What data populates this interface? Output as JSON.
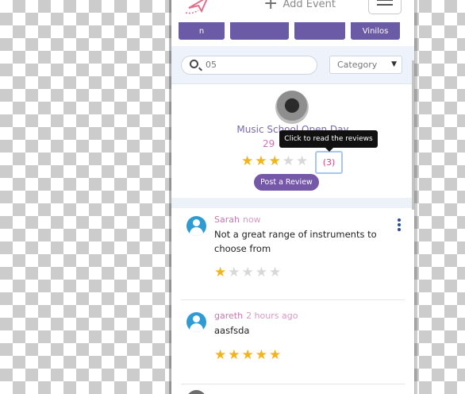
{
  "header": {
    "add_event_label": "Add Event",
    "plus_icon": "plus-icon",
    "menu_icon": "hamburger-icon"
  },
  "chips": [
    "n",
    "",
    "",
    "Vinilos"
  ],
  "search": {
    "value": "05",
    "placeholder": "Search"
  },
  "category": {
    "selected": "Category"
  },
  "event": {
    "title": "Music School Open Day",
    "date": "29",
    "rating": 3,
    "max_rating": 5,
    "review_count": "(3)",
    "tooltip": "Click to read the reviews",
    "post_review_label": "Post a Review"
  },
  "reviews": [
    {
      "name": "Sarah",
      "time": "now",
      "text": "Not a great range of instruments to choose from",
      "rating": 1
    },
    {
      "name": "gareth",
      "time": "2 hours ago",
      "text": "aasfsda",
      "rating": 5
    }
  ],
  "colors": {
    "accent": "#7658a8",
    "star": "#f3b41b",
    "name": "#c47aae",
    "avatar": "#2e9bd3"
  }
}
